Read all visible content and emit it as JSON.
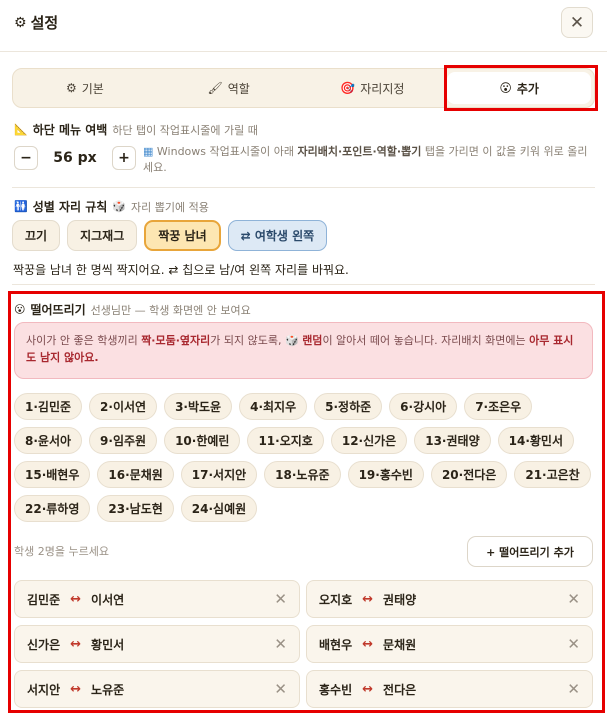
{
  "header": {
    "title": "설정",
    "gear_icon": "⚙",
    "close_icon": "✕"
  },
  "tabs": [
    {
      "icon": "⚙",
      "label": "기본"
    },
    {
      "icon": "🖌",
      "label": "역할"
    },
    {
      "icon": "🎯",
      "label": "자리지정"
    },
    {
      "icon": "😮",
      "label": "추가"
    }
  ],
  "menu_margin": {
    "icon": "📐",
    "label": "하단 메뉴 여백",
    "hint": "하단 탭이 작업표시줄에 가릴 때",
    "minus": "−",
    "value": "56 px",
    "plus": "+",
    "note_icon": "▦",
    "note_pre": "Windows 작업표시줄이 아래 ",
    "note_bold": "자리배치·포인트·역할·뽑기",
    "note_post": " 탭을 가리면 이 값을 키워 위로 올리세요."
  },
  "gender_rule": {
    "icon": "🚻",
    "label": "성별 자리 규칙",
    "hint_icon": "🎲",
    "hint": "자리 뽑기에 적용",
    "options": [
      "끄기",
      "지그재그",
      "짝꿍 남녀",
      "⇄ 여학생 왼쪽"
    ],
    "description": "짝꿍을 남녀 한 명씩 짝지어요. ⇄ 칩으로 남/여 왼쪽 자리를 바꿔요."
  },
  "separate": {
    "icon": "😮",
    "label": "떨어뜨리기",
    "hint": "선생님만 — 학생 화면엔 안 보여요",
    "warn_1": "사이가 안 좋은 학생끼리 ",
    "warn_b1": "짝·모둠·옆자리",
    "warn_2": "가 되지 않도록, ",
    "warn_icon": "🎲",
    "warn_b2": "랜덤",
    "warn_3": "이 알아서 떼어 놓습니다. 자리배치 화면에는 ",
    "warn_b3": "아무 표시도 남지 않아요.",
    "students": [
      "1·김민준",
      "2·이서연",
      "3·박도윤",
      "4·최지우",
      "5·정하준",
      "6·강시아",
      "7·조은우",
      "8·윤서아",
      "9·임주원",
      "10·한예린",
      "11·오지호",
      "12·신가은",
      "13·권태양",
      "14·황민서",
      "15·배현우",
      "16·문채원",
      "17·서지안",
      "18·노유준",
      "19·홍수빈",
      "20·전다은",
      "21·고은찬",
      "22·류하영",
      "23·남도현",
      "24·심예원"
    ],
    "pick_hint": "학생 2명을 누르세요",
    "add_label": "+ 떨어뜨리기 추가",
    "pairs": [
      {
        "a": "김민준",
        "b": "이서연"
      },
      {
        "a": "오지호",
        "b": "권태양"
      },
      {
        "a": "신가은",
        "b": "황민서"
      },
      {
        "a": "배현우",
        "b": "문채원"
      },
      {
        "a": "서지안",
        "b": "노유준"
      },
      {
        "a": "홍수빈",
        "b": "전다은"
      }
    ],
    "pair_arrow": "↔",
    "remove_icon": "✕"
  }
}
